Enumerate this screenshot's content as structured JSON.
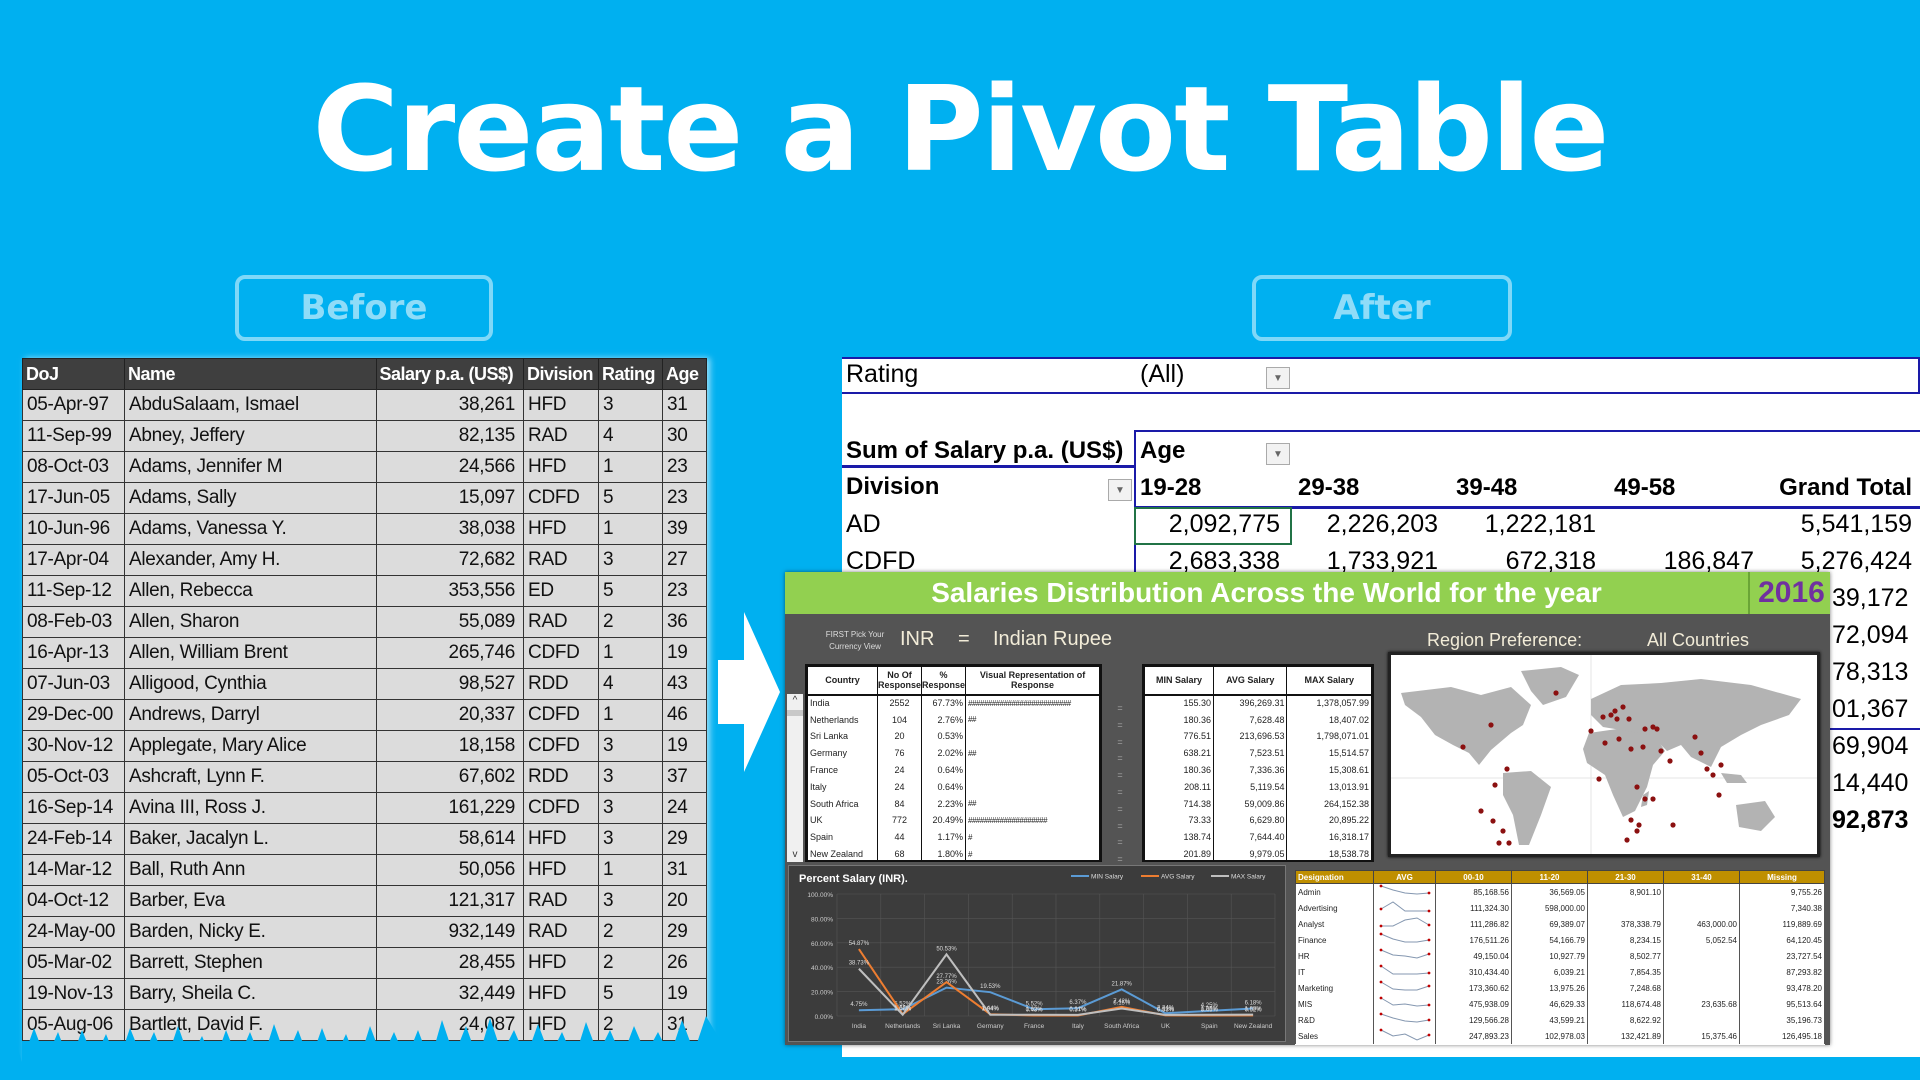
{
  "title": "Create a Pivot Table",
  "labels": {
    "before": "Before",
    "after": "After"
  },
  "before_table": {
    "columns": [
      "DoJ",
      "Name",
      "Salary p.a. (US$)",
      "Division",
      "Rating",
      "Age"
    ],
    "rows": [
      [
        "05-Apr-97",
        "AbduSalaam, Ismael",
        "38,261",
        "HFD",
        "3",
        "31"
      ],
      [
        "11-Sep-99",
        "Abney, Jeffery",
        "82,135",
        "RAD",
        "4",
        "30"
      ],
      [
        "08-Oct-03",
        "Adams, Jennifer M",
        "24,566",
        "HFD",
        "1",
        "23"
      ],
      [
        "17-Jun-05",
        "Adams, Sally",
        "15,097",
        "CDFD",
        "5",
        "23"
      ],
      [
        "10-Jun-96",
        "Adams, Vanessa Y.",
        "38,038",
        "HFD",
        "1",
        "39"
      ],
      [
        "17-Apr-04",
        "Alexander, Amy H.",
        "72,682",
        "RAD",
        "3",
        "27"
      ],
      [
        "11-Sep-12",
        "Allen, Rebecca",
        "353,556",
        "ED",
        "5",
        "23"
      ],
      [
        "08-Feb-03",
        "Allen, Sharon",
        "55,089",
        "RAD",
        "2",
        "36"
      ],
      [
        "16-Apr-13",
        "Allen, William Brent",
        "265,746",
        "CDFD",
        "1",
        "19"
      ],
      [
        "07-Jun-03",
        "Alligood, Cynthia",
        "98,527",
        "RDD",
        "4",
        "43"
      ],
      [
        "29-Dec-00",
        "Andrews, Darryl",
        "20,337",
        "CDFD",
        "1",
        "46"
      ],
      [
        "30-Nov-12",
        "Applegate, Mary Alice",
        "18,158",
        "CDFD",
        "3",
        "19"
      ],
      [
        "05-Oct-03",
        "Ashcraft, Lynn F.",
        "67,602",
        "RDD",
        "3",
        "37"
      ],
      [
        "16-Sep-14",
        "Avina III, Ross J.",
        "161,229",
        "CDFD",
        "3",
        "24"
      ],
      [
        "24-Feb-14",
        "Baker, Jacalyn L.",
        "58,614",
        "HFD",
        "3",
        "29"
      ],
      [
        "14-Mar-12",
        "Ball, Ruth Ann",
        "50,056",
        "HFD",
        "1",
        "31"
      ],
      [
        "04-Oct-12",
        "Barber, Eva",
        "121,317",
        "RAD",
        "3",
        "20"
      ],
      [
        "24-May-00",
        "Barden, Nicky E.",
        "932,149",
        "RAD",
        "2",
        "29"
      ],
      [
        "05-Mar-02",
        "Barrett, Stephen",
        "28,455",
        "HFD",
        "2",
        "26"
      ],
      [
        "19-Nov-13",
        "Barry, Sheila C.",
        "32,449",
        "HFD",
        "5",
        "19"
      ],
      [
        "05-Aug-06",
        "Bartlett, David F.",
        "24,087",
        "HFD",
        "2",
        "31"
      ]
    ]
  },
  "pivot": {
    "filter_label": "Rating",
    "filter_value": "(All)",
    "values_label": "Sum of Salary p.a. (US$)",
    "column_field": "Age",
    "row_field": "Division",
    "column_headers": [
      "19-28",
      "29-38",
      "39-48",
      "49-58",
      "Grand Total"
    ],
    "rows": [
      {
        "label": "AD",
        "values": [
          "2,092,775",
          "2,226,203",
          "1,222,181",
          "",
          "5,541,159"
        ]
      },
      {
        "label": "CDFD",
        "values": [
          "2,683,338",
          "1,733,921",
          "672,318",
          "186,847",
          "5,276,424"
        ]
      }
    ],
    "visible_total_fragments": [
      "39,172",
      "72,094",
      "78,313",
      "01,367",
      "69,904",
      "14,440",
      "92,873"
    ]
  },
  "dashboard": {
    "title": "Salaries Distribution Across the World for the year",
    "year": "2016",
    "currency_hint": "FIRST Pick Your Currency View",
    "currency_code": "INR",
    "equals": "=",
    "currency_name": "Indian Rupee",
    "region_label": "Region Preference:",
    "region_value": "All Countries",
    "country_table": {
      "columns": [
        "Country",
        "No Of Response",
        "% Response",
        "Visual Representation of Response"
      ],
      "rows": [
        [
          "India",
          "2552",
          "67.73%",
          "##########################"
        ],
        [
          "Netherlands",
          "104",
          "2.76%",
          "##"
        ],
        [
          "Sri Lanka",
          "20",
          "0.53%",
          ""
        ],
        [
          "Germany",
          "76",
          "2.02%",
          "##"
        ],
        [
          "France",
          "24",
          "0.64%",
          ""
        ],
        [
          "Italy",
          "24",
          "0.64%",
          ""
        ],
        [
          "South Africa",
          "84",
          "2.23%",
          "##"
        ],
        [
          "UK",
          "772",
          "20.49%",
          "####################"
        ],
        [
          "Spain",
          "44",
          "1.17%",
          "#"
        ],
        [
          "New Zealand",
          "68",
          "1.80%",
          "#"
        ]
      ]
    },
    "salary_table": {
      "columns": [
        "MIN Salary",
        "AVG Salary",
        "MAX Salary"
      ],
      "rows": [
        [
          "155.30",
          "396,269.31",
          "1,378,057.99"
        ],
        [
          "180.36",
          "7,628.48",
          "18,407.02"
        ],
        [
          "776.51",
          "213,696.53",
          "1,798,071.01"
        ],
        [
          "638.21",
          "7,523.51",
          "15,514.57"
        ],
        [
          "180.36",
          "7,336.36",
          "15,308.61"
        ],
        [
          "208.11",
          "5,119.54",
          "13,013.91"
        ],
        [
          "714.38",
          "59,009.86",
          "264,152.38"
        ],
        [
          "73.33",
          "6,629.80",
          "20,895.22"
        ],
        [
          "138.74",
          "7,644.40",
          "16,318.17"
        ],
        [
          "201.89",
          "9,979.05",
          "18,538.78"
        ]
      ]
    },
    "designation_table": {
      "columns": [
        "Designation",
        "AVG",
        "00-10",
        "11-20",
        "21-30",
        "31-40",
        "Missing"
      ],
      "rows": [
        [
          "Admin",
          "",
          "85,168.56",
          "36,569.05",
          "8,901.10",
          "",
          "9,755.26"
        ],
        [
          "Advertising",
          "",
          "111,324.30",
          "598,000.00",
          "",
          "",
          "7,340.38"
        ],
        [
          "Analyst",
          "",
          "111,286.82",
          "69,389.07",
          "378,338.79",
          "463,000.00",
          "119,889.69"
        ],
        [
          "Finance",
          "",
          "176,511.26",
          "54,166.79",
          "8,234.15",
          "5,052.54",
          "64,120.45"
        ],
        [
          "HR",
          "",
          "49,150.04",
          "10,927.79",
          "8,502.77",
          "",
          "23,727.54"
        ],
        [
          "IT",
          "",
          "310,434.40",
          "6,039.21",
          "7,854.35",
          "",
          "87,293.82"
        ],
        [
          "Marketing",
          "",
          "173,360.62",
          "13,975.26",
          "7,248.68",
          "",
          "93,478.20"
        ],
        [
          "MIS",
          "",
          "475,938.09",
          "46,629.33",
          "118,674.48",
          "23,635.68",
          "95,513.64"
        ],
        [
          "R&D",
          "",
          "129,566.28",
          "43,599.21",
          "8,622.92",
          "",
          "35,196.73"
        ],
        [
          "Sales",
          "",
          "247,893.23",
          "102,978.03",
          "132,421.89",
          "15,375.46",
          "126,495.18"
        ]
      ]
    },
    "scroll": {
      "up": "^",
      "down": "v"
    }
  },
  "chart_data": {
    "type": "line",
    "title": "Percent Salary (INR).",
    "categories": [
      "India",
      "Netherlands",
      "Sri Lanka",
      "Germany",
      "France",
      "Italy",
      "South Africa",
      "UK",
      "Spain",
      "New Zealand"
    ],
    "series": [
      {
        "name": "MIN Salary",
        "color": "#5b9bd5",
        "values": [
          4.75,
          5.52,
          23.26,
          19.53,
          5.52,
          6.37,
          21.87,
          2.24,
          4.25,
          6.18
        ]
      },
      {
        "name": "AVG Salary",
        "color": "#ed7d31",
        "values": [
          54.87,
          1.52,
          27.77,
          1.44,
          0.43,
          0.37,
          7.42,
          0.53,
          0.46,
          0.52
        ]
      },
      {
        "name": "MAX Salary",
        "color": "#bfbfbf",
        "values": [
          38.73,
          1.06,
          50.53,
          1.04,
          1.02,
          0.91,
          6.15,
          0.92,
          1.06,
          1.08
        ]
      }
    ],
    "ylabel": "",
    "xlabel": "",
    "ylim": [
      0,
      100
    ],
    "yticks": [
      "0.00%",
      "20.00%",
      "40.00%",
      "60.00%",
      "80.00%",
      "100.00%"
    ],
    "grid": true,
    "legend": "top-right"
  },
  "colors": {
    "background": "#00b0f0",
    "dashboard_header": "#92d050",
    "year": "#7030a0",
    "pivot_border": "#1a1aa8",
    "designation_header": "#bf8f00"
  }
}
